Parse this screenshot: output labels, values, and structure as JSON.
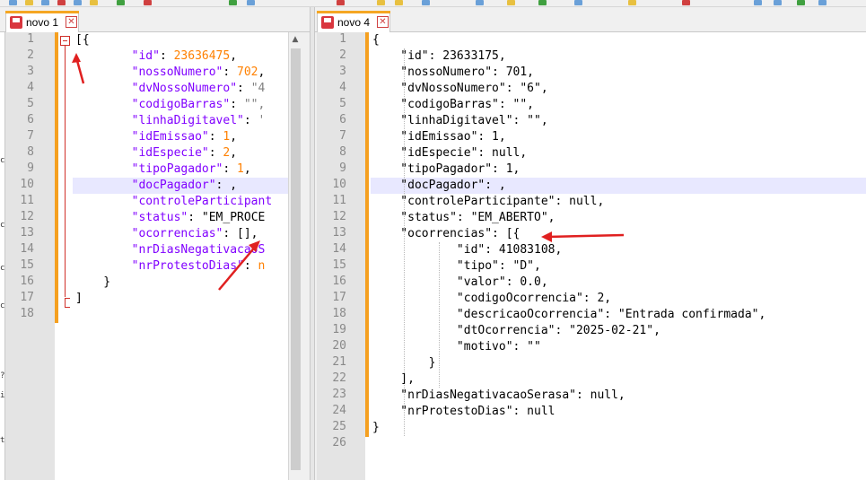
{
  "left_tab": {
    "label": "novo 1",
    "close": "✕"
  },
  "right_tab": {
    "label": "novo 4",
    "close": "✕"
  },
  "left_editor": {
    "line_numbers": [
      "1",
      "2",
      "3",
      "4",
      "5",
      "6",
      "7",
      "8",
      "9",
      "10",
      "11",
      "12",
      "13",
      "14",
      "15",
      "16",
      "17",
      "18"
    ],
    "lines": [
      [
        {
          "t": "[{",
          "c": "b"
        }
      ],
      [
        {
          "t": "        ",
          "c": "p"
        },
        {
          "t": "\"id\"",
          "c": "k"
        },
        {
          "t": ": ",
          "c": "p"
        },
        {
          "t": "23636475",
          "c": "n"
        },
        {
          "t": ",",
          "c": "p"
        }
      ],
      [
        {
          "t": "        ",
          "c": "p"
        },
        {
          "t": "\"nossoNumero\"",
          "c": "k"
        },
        {
          "t": ": ",
          "c": "p"
        },
        {
          "t": "702",
          "c": "n"
        },
        {
          "t": ",",
          "c": "p"
        }
      ],
      [
        {
          "t": "        ",
          "c": "p"
        },
        {
          "t": "\"dvNossoNumero\"",
          "c": "k"
        },
        {
          "t": ": ",
          "c": "p"
        },
        {
          "t": "\"4",
          "c": "s"
        }
      ],
      [
        {
          "t": "        ",
          "c": "p"
        },
        {
          "t": "\"codigoBarras\"",
          "c": "k"
        },
        {
          "t": ": ",
          "c": "p"
        },
        {
          "t": "\"\",",
          "c": "s"
        }
      ],
      [
        {
          "t": "        ",
          "c": "p"
        },
        {
          "t": "\"linhaDigitavel\"",
          "c": "k"
        },
        {
          "t": ": ",
          "c": "p"
        },
        {
          "t": "'",
          "c": "s"
        }
      ],
      [
        {
          "t": "        ",
          "c": "p"
        },
        {
          "t": "\"idEmissao\"",
          "c": "k"
        },
        {
          "t": ": ",
          "c": "p"
        },
        {
          "t": "1",
          "c": "n"
        },
        {
          "t": ",",
          "c": "p"
        }
      ],
      [
        {
          "t": "        ",
          "c": "p"
        },
        {
          "t": "\"idEspecie\"",
          "c": "k"
        },
        {
          "t": ": ",
          "c": "p"
        },
        {
          "t": "2",
          "c": "n"
        },
        {
          "t": ",",
          "c": "p"
        }
      ],
      [
        {
          "t": "        ",
          "c": "p"
        },
        {
          "t": "\"tipoPagador\"",
          "c": "k"
        },
        {
          "t": ": ",
          "c": "p"
        },
        {
          "t": "1",
          "c": "n"
        },
        {
          "t": ",",
          "c": "p"
        }
      ],
      [
        {
          "t": "        ",
          "c": "p"
        },
        {
          "t": "\"docPagador\"",
          "c": "k"
        },
        {
          "t": ": ,",
          "c": "p"
        }
      ],
      [
        {
          "t": "        ",
          "c": "p"
        },
        {
          "t": "\"controleParticipant",
          "c": "k"
        }
      ],
      [
        {
          "t": "        ",
          "c": "p"
        },
        {
          "t": "\"status\"",
          "c": "k"
        },
        {
          "t": ": ",
          "c": "p"
        },
        {
          "t": "\"EM_PROCE",
          "c": "b"
        }
      ],
      [
        {
          "t": "        ",
          "c": "p"
        },
        {
          "t": "\"ocorrencias\"",
          "c": "k"
        },
        {
          "t": ": [],",
          "c": "p"
        }
      ],
      [
        {
          "t": "        ",
          "c": "p"
        },
        {
          "t": "\"nrDiasNegativacaoS",
          "c": "k"
        }
      ],
      [
        {
          "t": "        ",
          "c": "p"
        },
        {
          "t": "\"nrProtestoDias\"",
          "c": "k"
        },
        {
          "t": ": ",
          "c": "p"
        },
        {
          "t": "n",
          "c": "n"
        }
      ],
      [
        {
          "t": "    }",
          "c": "b"
        }
      ],
      [
        {
          "t": "]",
          "c": "b"
        }
      ],
      [
        {
          "t": "",
          "c": "p"
        }
      ]
    ]
  },
  "right_editor": {
    "line_numbers": [
      "1",
      "2",
      "3",
      "4",
      "5",
      "6",
      "7",
      "8",
      "9",
      "10",
      "11",
      "12",
      "13",
      "14",
      "15",
      "16",
      "17",
      "18",
      "19",
      "20",
      "21",
      "22",
      "23",
      "24",
      "25",
      "26"
    ],
    "lines": [
      "{",
      "    \"id\": 23633175,",
      "    \"nossoNumero\": 701,",
      "    \"dvNossoNumero\": \"6\",",
      "    \"codigoBarras\": \"\",",
      "    \"linhaDigitavel\": \"\",",
      "    \"idEmissao\": 1,",
      "    \"idEspecie\": null,",
      "    \"tipoPagador\": 1,",
      "    \"docPagador\": ,",
      "    \"controleParticipante\": null,",
      "    \"status\": \"EM_ABERTO\",",
      "    \"ocorrencias\": [{",
      "            \"id\": 41083108,",
      "            \"tipo\": \"D\",",
      "            \"valor\": 0.0,",
      "            \"codigoOcorrencia\": 2,",
      "            \"descricaoOcorrencia\": \"Entrada confirmada\",",
      "            \"dtOcorrencia\": \"2025-02-21\",",
      "            \"motivo\": \"\"",
      "        }",
      "    ],",
      "    \"nrDiasNegativacaoSerasa\": null,",
      "    \"nrProtestoDias\": null",
      "}",
      ""
    ]
  },
  "colors": {
    "accent": "#f5a020",
    "arrow": "#e02020",
    "current_line": "#e8e8ff"
  }
}
